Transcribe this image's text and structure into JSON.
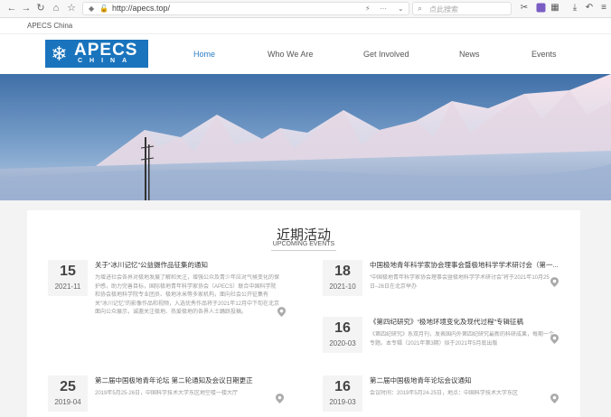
{
  "browser": {
    "url": "http://apecs.top/",
    "search_placeholder": "点此搜索"
  },
  "site": {
    "top_label": "APECS China",
    "logo_main": "APECS",
    "logo_sub": "CHINA"
  },
  "nav": {
    "items": [
      {
        "label": "Home"
      },
      {
        "label": "Who We Are"
      },
      {
        "label": "Get Involved"
      },
      {
        "label": "News"
      },
      {
        "label": "Events"
      }
    ]
  },
  "events_section": {
    "title": "近期活动",
    "subtitle": "UPCOMING EVENTS",
    "events": [
      {
        "day": "15",
        "ym": "2021-11",
        "title": "关于“冰川记忆”公益摄作品征集的通知",
        "desc": "为增进社会各界对极地发展了解和关注，增强公众及青少年应对气候变化的保护感，助力完善目标，国际极地青年科学家协会（APECS）联合中国科学院和协会极地科学院专业团员、极地冰米等多家机构，面向社会公开征集有关“冰川记忆”的影像作品和视频，入选优秀作品将于2021年12月中下旬在北京面向公众展示，诚邀关注极地、热爱极地的各界人士踊跃投稿。"
      },
      {
        "day": "18",
        "ym": "2021-10",
        "title": "中国极地青年科学家协会理事会暨极地科学学术研讨会（第一...",
        "desc": "“中国极地青年科学家协会理事会暨极地科学学术研讨会”将于2021年10月25日–26日在北京举办"
      },
      {
        "day": "16",
        "ym": "2020-03",
        "title": "《第四纪研究》“极地环境变化及现代过程”专辑征稿",
        "desc": "《第四纪研究》系双月刊，发表国内外第四纪研究最新的科研成果，每期一个专题。本专辑（2021年第3期）拟于2021年5月底出版"
      },
      {
        "day": "25",
        "ym": "2019-04",
        "title": "第二届中国极地青年论坛 第二轮通知及会议日期更正",
        "desc": "2019年5月25-26日，中国科学技术大学东区地空楼一楼大厅"
      },
      {
        "day": "16",
        "ym": "2019-03",
        "title": "第二届中国极地青年论坛会议通知",
        "desc": "会议时间：2019年5月24-25日，地点：中国科学技术大学东区"
      }
    ]
  },
  "colors": {
    "brand": "#1a74bd",
    "nav_active": "#2a7dc4"
  }
}
